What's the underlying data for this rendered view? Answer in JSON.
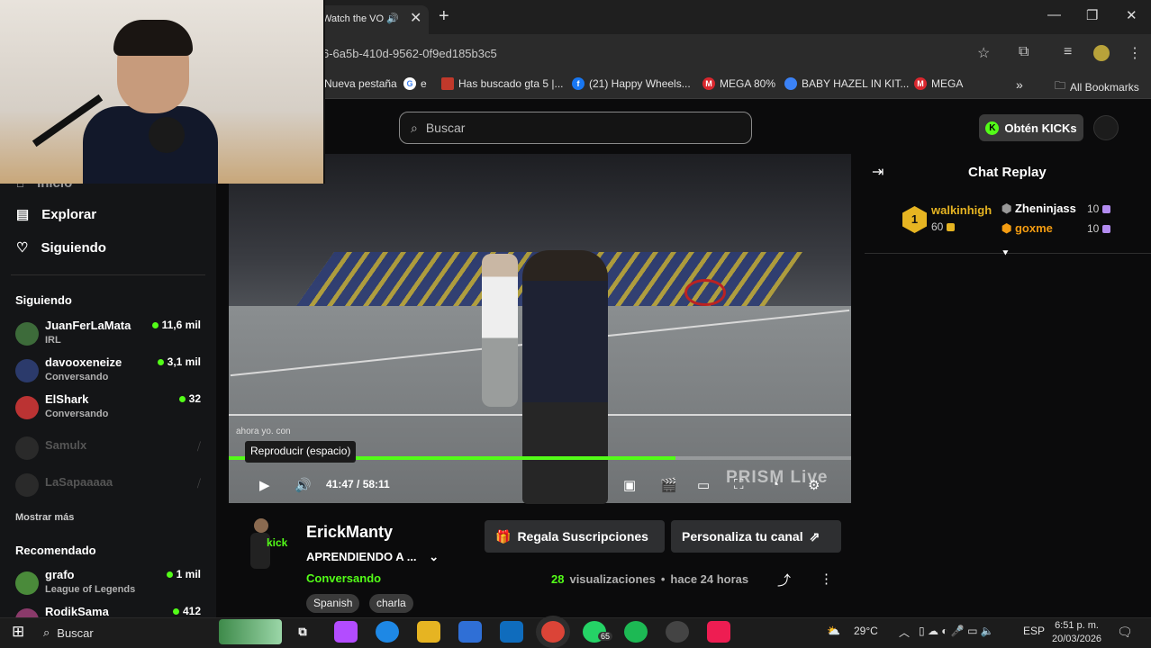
{
  "browser": {
    "tab_title": "Watch the VO",
    "url": "6-6a5b-410d-9562-0f9ed185b3c5",
    "bookmarks": [
      {
        "label": "Nueva pestaña",
        "color": "#2b2b2b"
      },
      {
        "label": "e",
        "color": "#4285f4"
      },
      {
        "label": "Has buscado gta 5 |...",
        "color": "#c0392b"
      },
      {
        "label": "(21) Happy Wheels...",
        "color": "#1877f2"
      },
      {
        "label": "MEGA 80%",
        "color": "#d9272e"
      },
      {
        "label": "BABY HAZEL IN KIT...",
        "color": "#3b82f6"
      },
      {
        "label": "MEGA",
        "color": "#d9272e"
      }
    ],
    "all_bookmarks": "All Bookmarks"
  },
  "header": {
    "search_placeholder": "Buscar",
    "kicks_button": "Obtén KICKs"
  },
  "sidebar": {
    "nav": [
      {
        "label": "Inicio"
      },
      {
        "label": "Explorar"
      },
      {
        "label": "Siguiendo"
      }
    ],
    "following_title": "Siguiendo",
    "following": [
      {
        "name": "JuanFerLaMata",
        "sub": "IRL",
        "viewers": "11,6 mil",
        "color": "#3d6b3a"
      },
      {
        "name": "davooxeneize",
        "sub": "Conversando",
        "viewers": "3,1 mil",
        "color": "#2b3a6b"
      },
      {
        "name": "ElShark",
        "sub": "Conversando",
        "viewers": "32",
        "color": "#b33"
      }
    ],
    "offline": [
      {
        "name": "Samulx"
      },
      {
        "name": "LaSapaaaaa"
      }
    ],
    "show_more": "Mostrar más",
    "recommended_title": "Recomendado",
    "recommended": [
      {
        "name": "grafo",
        "sub": "League of Legends",
        "viewers": "1 mil",
        "color": "#4a8a3a"
      },
      {
        "name": "RodikSama",
        "sub": "",
        "viewers": "412",
        "color": "#8a3a6a"
      }
    ]
  },
  "player": {
    "overlay_chat": "ahora yo. con",
    "tooltip": "Reproducir (espacio)",
    "time": "41:47 / 58:11",
    "progress": 0.718,
    "watermark": "PRISM Live"
  },
  "chat": {
    "title": "Chat Replay",
    "top_gifter": {
      "rank": "1",
      "name": "walkinhigh",
      "amount": "60"
    },
    "gifters": [
      {
        "name": "Zheninjass",
        "amount": "10",
        "color": "#ffffff"
      },
      {
        "name": "goxme",
        "amount": "10",
        "color": "#f39c12"
      }
    ]
  },
  "stream": {
    "streamer": "ErickManty",
    "title": "APRENDIENDO A ...",
    "category": "Conversando",
    "tags": [
      "Spanish",
      "charla"
    ],
    "gift_button": "Regala Suscripciones",
    "customize_button": "Personaliza tu canal",
    "views_count": "28",
    "views_label": "visualizaciones",
    "time_ago": "hace 24 horas"
  },
  "taskbar": {
    "search": "Buscar",
    "whatsapp_badge": "65",
    "weather": "29°C",
    "lang": "ESP",
    "time": "6:51 p. m.",
    "date": "20/03/2026"
  },
  "colors": {
    "accent": "#53fc18",
    "background": "#0b0b0c",
    "sidebar": "#141517"
  }
}
